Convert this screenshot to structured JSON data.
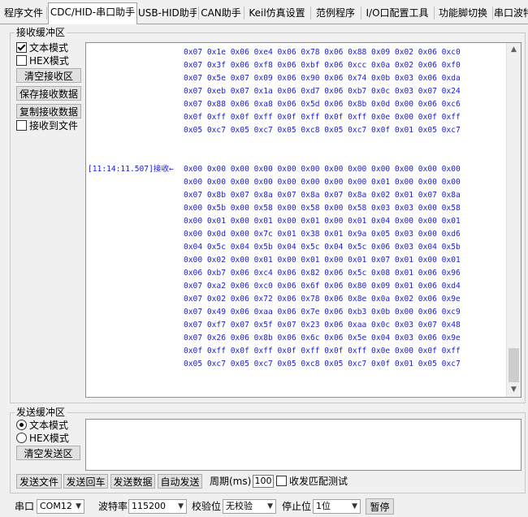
{
  "tabs": [
    {
      "label": "程序文件"
    },
    {
      "label": "CDC/HID-串口助手"
    },
    {
      "label": "USB-HID助手"
    },
    {
      "label": "CAN助手"
    },
    {
      "label": "Keil仿真设置"
    },
    {
      "label": "范例程序"
    },
    {
      "label": "I/O口配置工具"
    },
    {
      "label": "功能脚切换"
    },
    {
      "label": "串口波特"
    }
  ],
  "receive": {
    "group_title": "接收缓冲区",
    "text_mode": "文本模式",
    "hex_mode": "HEX模式",
    "clear_btn": "清空接收区",
    "save_btn": "保存接收数据",
    "copy_btn": "复制接收数据",
    "to_file": "接收到文件",
    "timestamp_line": "[11:14:11.507]接收←",
    "lines_top": [
      "0x07 0x1e 0x06 0xe4 0x06 0x78 0x06 0x88 0x09 0x02 0x06 0xc0",
      "0x07 0x3f 0x06 0xf8 0x06 0xbf 0x06 0xcc 0x0a 0x02 0x06 0xf0",
      "0x07 0x5e 0x07 0x09 0x06 0x90 0x06 0x74 0x0b 0x03 0x06 0xda",
      "0x07 0xeb 0x07 0x1a 0x06 0xd7 0x06 0xb7 0x0c 0x03 0x07 0x24",
      "0x07 0x88 0x06 0xa8 0x06 0x5d 0x06 0x8b 0x0d 0x00 0x06 0xc6",
      "0x0f 0xff 0x0f 0xff 0x0f 0xff 0x0f 0xff 0x0e 0x00 0x0f 0xff",
      "0x05 0xc7 0x05 0xc7 0x05 0xc8 0x05 0xc7 0x0f 0x01 0x05 0xc7"
    ],
    "lines_bottom": [
      "0x00 0x00 0x00 0x00 0x00 0x00 0x00 0x00 0x00 0x00 0x00 0x00",
      "0x00 0x00 0x00 0x00 0x00 0x00 0x00 0x00 0x01 0x00 0x00 0x00",
      "0x07 0x8b 0x07 0x8a 0x07 0x8a 0x07 0x8a 0x02 0x01 0x07 0x8a",
      "0x00 0x5b 0x00 0x58 0x00 0x58 0x00 0x58 0x03 0x03 0x00 0x58",
      "0x00 0x01 0x00 0x01 0x00 0x01 0x00 0x01 0x04 0x00 0x00 0x01",
      "0x00 0x0d 0x00 0x7c 0x01 0x38 0x01 0x9a 0x05 0x03 0x00 0xd6",
      "0x04 0x5c 0x04 0x5b 0x04 0x5c 0x04 0x5c 0x06 0x03 0x04 0x5b",
      "0x00 0x02 0x00 0x01 0x00 0x01 0x00 0x01 0x07 0x01 0x00 0x01",
      "0x06 0xb7 0x06 0xc4 0x06 0x82 0x06 0x5c 0x08 0x01 0x06 0x96",
      "0x07 0xa2 0x06 0xc0 0x06 0x6f 0x06 0x80 0x09 0x01 0x06 0xd4",
      "0x07 0x02 0x06 0x72 0x06 0x78 0x06 0x8e 0x0a 0x02 0x06 0x9e",
      "0x07 0x49 0x06 0xaa 0x06 0x7e 0x06 0xb3 0x0b 0x00 0x06 0xc9",
      "0x07 0xf7 0x07 0x5f 0x07 0x23 0x06 0xaa 0x0c 0x03 0x07 0x48",
      "0x07 0x26 0x06 0x8b 0x06 0x6c 0x06 0x5e 0x04 0x03 0x06 0x9e",
      "0x0f 0xff 0x0f 0xff 0x0f 0xff 0x0f 0xff 0x0e 0x00 0x0f 0xff",
      "0x05 0xc7 0x05 0xc7 0x05 0xc8 0x05 0xc7 0x0f 0x01 0x05 0xc7"
    ]
  },
  "send": {
    "group_title": "发送缓冲区",
    "text_mode": "文本模式",
    "hex_mode": "HEX模式",
    "clear_btn": "清空发送区",
    "send_file": "发送文件",
    "send_enter": "发送回车",
    "send_data": "发送数据",
    "auto_send": "自动发送",
    "period_label": "周期(ms)",
    "period_value": "100",
    "match_test": "收发匹配测试"
  },
  "bottom": {
    "port_label": "串口",
    "port_value": "COM12",
    "baud_label": "波特率",
    "baud_value": "115200",
    "parity_label": "校验位",
    "parity_value": "无校验",
    "stop_label": "停止位",
    "stop_value": "1位",
    "pause_btn": "暂停"
  },
  "colors": {
    "hex_text": "#1c1ccf"
  }
}
